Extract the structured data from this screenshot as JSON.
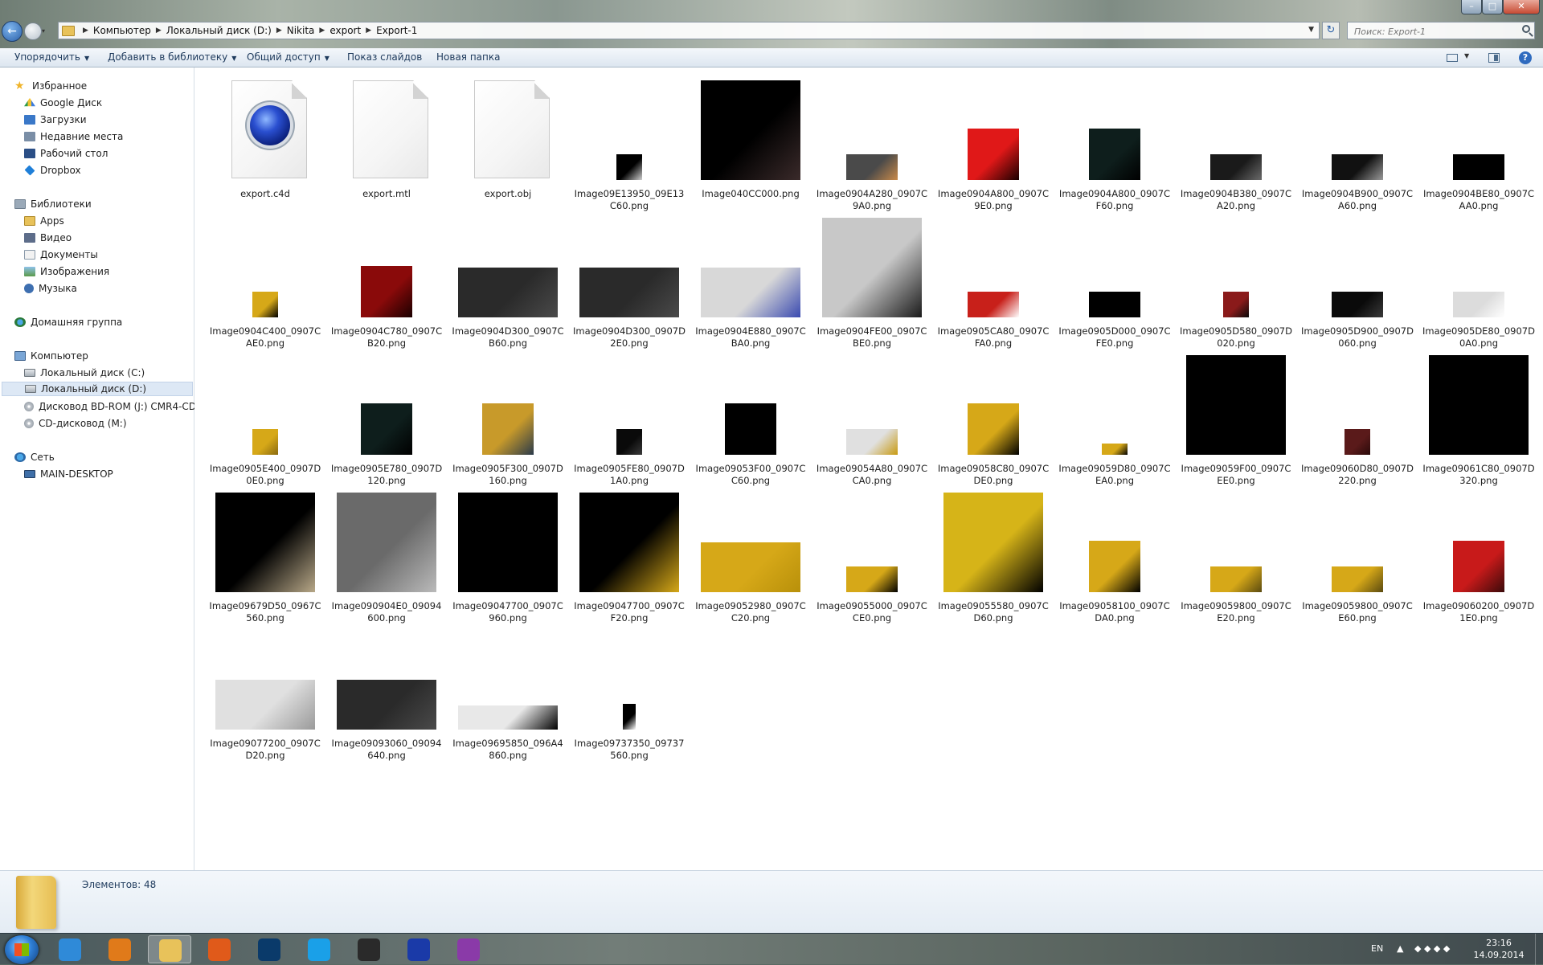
{
  "window": {
    "breadcrumb": [
      "Компьютер",
      "Локальный диск (D:)",
      "Nikita",
      "export",
      "Export-1"
    ],
    "search_placeholder": "Поиск: Export-1"
  },
  "toolbar": {
    "organize": "Упорядочить",
    "add_to_library": "Добавить в библиотеку",
    "share": "Общий доступ",
    "slideshow": "Показ слайдов",
    "new_folder": "Новая папка"
  },
  "navpane": {
    "favorites": "Избранное",
    "favorites_items": [
      "Google Диск",
      "Загрузки",
      "Недавние места",
      "Рабочий стол",
      "Dropbox"
    ],
    "libraries": "Библиотеки",
    "libraries_items": [
      "Apps",
      "Видео",
      "Документы",
      "Изображения",
      "Музыка"
    ],
    "homegroup": "Домашняя группа",
    "computer": "Компьютер",
    "computer_items": [
      "Локальный диск (C:)",
      "Локальный диск (D:)",
      "Дисковод BD-ROM (J:) CMR4-CD2",
      "CD-дисковод (M:)"
    ],
    "network": "Сеть",
    "network_items": [
      "MAIN-DESKTOP"
    ]
  },
  "files": [
    {
      "name": "export.c4d",
      "kind": "c4d"
    },
    {
      "name": "export.mtl",
      "kind": "doc"
    },
    {
      "name": "export.obj",
      "kind": "doc"
    },
    {
      "name": "Image09E13950_09E13C60.png",
      "size": "sm",
      "colors": [
        "#000000",
        "#d0d0d0"
      ]
    },
    {
      "name": "Image040CC000.png",
      "size": "lg",
      "colors": [
        "#000000",
        "#3a2a2a"
      ]
    },
    {
      "name": "Image0904A280_0907C9A0.png",
      "size": "wide",
      "colors": [
        "#4a4a4a",
        "#c98a4a"
      ]
    },
    {
      "name": "Image0904A800_0907C9E0.png",
      "size": "md",
      "colors": [
        "#e01818",
        "#1a0000"
      ]
    },
    {
      "name": "Image0904A800_0907CF60.png",
      "size": "md",
      "colors": [
        "#0e1e1c",
        "#000000"
      ]
    },
    {
      "name": "Image0904B380_0907CA20.png",
      "size": "wide",
      "colors": [
        "#1a1a1a",
        "#6a6a6a"
      ]
    },
    {
      "name": "Image0904B900_0907CA60.png",
      "size": "wide",
      "colors": [
        "#111111",
        "#9a9a9a"
      ]
    },
    {
      "name": "Image0904BE80_0907CAA0.png",
      "size": "wide",
      "colors": [
        "#000000",
        "#000000"
      ]
    },
    {
      "name": "Image0904C400_0907CAE0.png",
      "size": "sm",
      "colors": [
        "#d6a818",
        "#000000"
      ]
    },
    {
      "name": "Image0904C780_0907CB20.png",
      "size": "md",
      "colors": [
        "#8a0a0a",
        "#1a0000"
      ]
    },
    {
      "name": "Image0904D300_0907CB60.png",
      "size": "wide2",
      "colors": [
        "#2a2a2a",
        "#4a4a4a"
      ]
    },
    {
      "name": "Image0904D300_0907D2E0.png",
      "size": "wide2",
      "colors": [
        "#2a2a2a",
        "#4a4a4a"
      ]
    },
    {
      "name": "Image0904E880_0907CBA0.png",
      "size": "wide2",
      "colors": [
        "#d8d8d8",
        "#3a4ab0"
      ]
    },
    {
      "name": "Image0904FE00_0907CBE0.png",
      "size": "lg",
      "colors": [
        "#c8c8c8",
        "#1a1a1a"
      ]
    },
    {
      "name": "Image0905CA80_0907CFA0.png",
      "size": "wide",
      "colors": [
        "#c8201a",
        "#ffffff"
      ]
    },
    {
      "name": "Image0905D000_0907CFE0.png",
      "size": "wide",
      "colors": [
        "#000000",
        "#000000"
      ]
    },
    {
      "name": "Image0905D580_0907D020.png",
      "size": "sm",
      "colors": [
        "#8a1a1a",
        "#0a0a0a"
      ]
    },
    {
      "name": "Image0905D900_0907D060.png",
      "size": "wide",
      "colors": [
        "#0a0a0a",
        "#3a3a3a"
      ]
    },
    {
      "name": "Image0905DE80_0907D0A0.png",
      "size": "wide",
      "colors": [
        "#dcdcdc",
        "#ffffff"
      ]
    },
    {
      "name": "Image0905E400_0907D0E0.png",
      "size": "sm",
      "colors": [
        "#d6a818",
        "#8a6a10"
      ]
    },
    {
      "name": "Image0905E780_0907D120.png",
      "size": "md",
      "colors": [
        "#0e1e1c",
        "#000000"
      ]
    },
    {
      "name": "Image0905F300_0907D160.png",
      "size": "md",
      "colors": [
        "#c89a2a",
        "#2a3a4a"
      ]
    },
    {
      "name": "Image0905FE80_0907D1A0.png",
      "size": "sm",
      "colors": [
        "#0a0a0a",
        "#3a3a3a"
      ]
    },
    {
      "name": "Image09053F00_0907CC60.png",
      "size": "md",
      "colors": [
        "#000000",
        "#000000"
      ]
    },
    {
      "name": "Image09054A80_0907CCA0.png",
      "size": "wide",
      "colors": [
        "#e0e0e0",
        "#c89a10"
      ]
    },
    {
      "name": "Image09058C80_0907CDE0.png",
      "size": "md",
      "colors": [
        "#d6a818",
        "#000000"
      ]
    },
    {
      "name": "Image09059D80_0907CEA0.png",
      "size": "tiny",
      "colors": [
        "#d6a818",
        "#000000"
      ]
    },
    {
      "name": "Image09059F00_0907CEE0.png",
      "size": "lg",
      "colors": [
        "#000000",
        "#000000"
      ]
    },
    {
      "name": "Image09060D80_0907D220.png",
      "size": "sm",
      "colors": [
        "#5a1a1a",
        "#2a0a0a"
      ]
    },
    {
      "name": "Image09061C80_0907D320.png",
      "size": "lg",
      "colors": [
        "#000000",
        "#000000"
      ]
    },
    {
      "name": "Image09679D50_0967C560.png",
      "size": "lg",
      "colors": [
        "#000000",
        "#b8a888"
      ]
    },
    {
      "name": "Image090904E0_09094600.png",
      "size": "lg",
      "colors": [
        "#6a6a6a",
        "#bababa"
      ]
    },
    {
      "name": "Image09047700_0907C960.png",
      "size": "lg",
      "colors": [
        "#000000",
        "#000000"
      ]
    },
    {
      "name": "Image09047700_0907CF20.png",
      "size": "lg",
      "colors": [
        "#000000",
        "#d6a818"
      ]
    },
    {
      "name": "Image09052980_0907CC20.png",
      "size": "wide2",
      "colors": [
        "#d6a818",
        "#b8900a"
      ]
    },
    {
      "name": "Image09055000_0907CCE0.png",
      "size": "wide",
      "colors": [
        "#d6a818",
        "#000000"
      ]
    },
    {
      "name": "Image09055580_0907CD60.png",
      "size": "lg",
      "colors": [
        "#d6b418",
        "#000000"
      ]
    },
    {
      "name": "Image09058100_0907CDA0.png",
      "size": "md",
      "colors": [
        "#d6a818",
        "#000000"
      ]
    },
    {
      "name": "Image09059800_0907CE20.png",
      "size": "wide",
      "colors": [
        "#d6a818",
        "#5a4a10"
      ]
    },
    {
      "name": "Image09059800_0907CE60.png",
      "size": "wide",
      "colors": [
        "#d6a818",
        "#5a4a10"
      ]
    },
    {
      "name": "Image09060200_0907D1E0.png",
      "size": "md",
      "colors": [
        "#c81a1a",
        "#3a0a0a"
      ]
    },
    {
      "name": "Image09077200_0907CD20.png",
      "size": "wide2",
      "colors": [
        "#e0e0e0",
        "#9a9a9a"
      ]
    },
    {
      "name": "Image09093060_09094640.png",
      "size": "wide2",
      "colors": [
        "#2a2a2a",
        "#4a4a4a"
      ]
    },
    {
      "name": "Image09695850_096A4860.png",
      "size": "strip",
      "colors": [
        "#e8e8e8",
        "#000000"
      ]
    },
    {
      "name": "Image09737350_09737560.png",
      "size": "phone",
      "colors": [
        "#000000",
        "#ffffff"
      ]
    }
  ],
  "details": {
    "item_count": "Элементов: 48"
  },
  "taskbar": {
    "apps": [
      {
        "name": "internet-explorer",
        "color": "#2f8ad8"
      },
      {
        "name": "media-player",
        "color": "#e07a1a"
      },
      {
        "name": "explorer",
        "color": "#e8c25a"
      },
      {
        "name": "firefox",
        "color": "#e05a1a"
      },
      {
        "name": "photoshop",
        "color": "#0a3a6a"
      },
      {
        "name": "skype",
        "color": "#1aa0e8"
      },
      {
        "name": "unity",
        "color": "#2a2a2a"
      },
      {
        "name": "cinema4d",
        "color": "#1a3aa8"
      },
      {
        "name": "winrar",
        "color": "#8a3aa8"
      }
    ],
    "lang": "EN",
    "time": "23:16",
    "date": "14.09.2014"
  }
}
